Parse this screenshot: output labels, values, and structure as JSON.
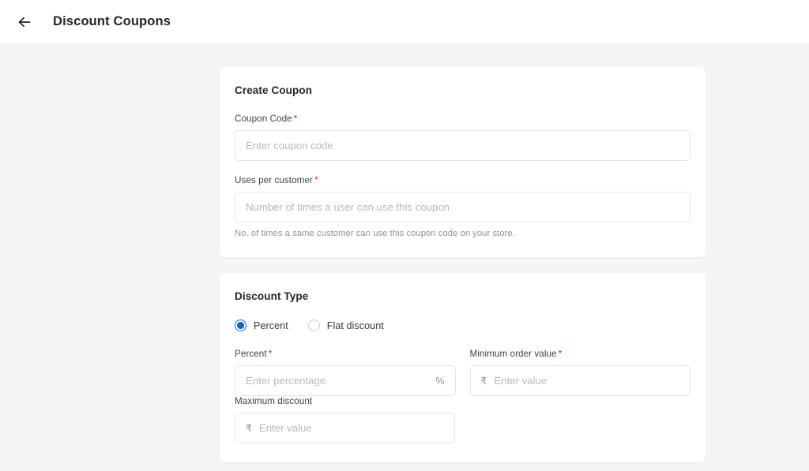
{
  "header": {
    "back_icon": "arrow-left-icon",
    "title": "Discount Coupons"
  },
  "cards": {
    "create_coupon": {
      "title": "Create Coupon",
      "fields": {
        "coupon_code": {
          "label": "Coupon Code",
          "required_marker": "*",
          "placeholder": "Enter coupon code",
          "value": ""
        },
        "uses_per_customer": {
          "label": "Uses per customer",
          "required_marker": "*",
          "placeholder": "Number of times a user can use this coupon",
          "value": "",
          "help": "No. of times a same customer can use this coupon code on your store."
        }
      }
    },
    "discount_type": {
      "title": "Discount Type",
      "options": [
        {
          "label": "Percent",
          "selected": true
        },
        {
          "label": "Flat discount",
          "selected": false
        }
      ],
      "fields": {
        "percent": {
          "label": "Percent",
          "required_marker": "*",
          "placeholder": "Enter percentage",
          "value": "",
          "suffix": "%"
        },
        "minimum_order_value": {
          "label": "Minimum order value",
          "required_marker": "*",
          "placeholder": "Enter value",
          "value": "",
          "prefix": "₹"
        },
        "maximum_discount": {
          "label": "Maximum discount",
          "required_marker": "",
          "placeholder": "Enter value",
          "value": "",
          "prefix": "₹"
        }
      }
    }
  },
  "colors": {
    "page_background": "#f5f5f6",
    "card_background": "#ffffff",
    "accent_radio": "#1565c9",
    "required_asterisk": "#ea1f3d",
    "input_border": "#e3e5e9",
    "placeholder_text": "#b4b8c0",
    "title_text": "#22262e",
    "help_text": "#8e939e"
  }
}
